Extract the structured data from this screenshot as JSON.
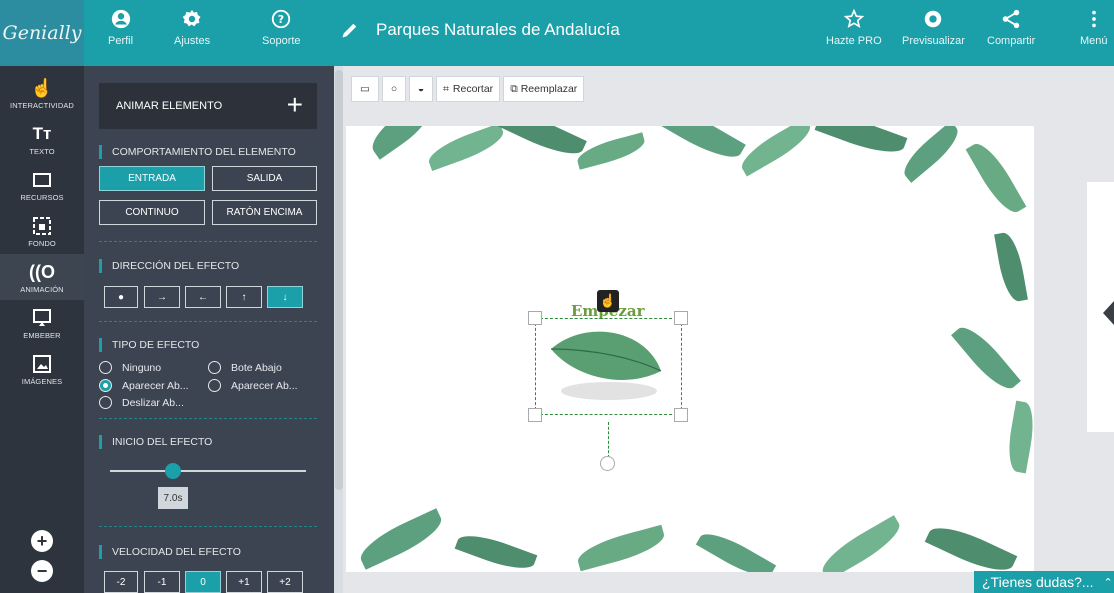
{
  "topbar": {
    "logo": "Genially",
    "perfil": "Perfil",
    "ajustes": "Ajustes",
    "soporte": "Soporte",
    "title": "Parques Naturales de Andalucía",
    "hazte_pro": "Hazte PRO",
    "previsualizar": "Previsualizar",
    "compartir": "Compartir",
    "menu": "Menú"
  },
  "rail": {
    "items": [
      {
        "label": "INTERACTIVIDAD",
        "icon": "hand-pointer-icon"
      },
      {
        "label": "TEXTO",
        "icon": "text-icon"
      },
      {
        "label": "RECURSOS",
        "icon": "resources-icon"
      },
      {
        "label": "FONDO",
        "icon": "background-icon"
      },
      {
        "label": "ANIMACIÓN",
        "icon": "animation-icon"
      },
      {
        "label": "EMBEBER",
        "icon": "embed-icon"
      },
      {
        "label": "IMÁGENES",
        "icon": "images-icon"
      }
    ],
    "zoom_in": "+",
    "zoom_out": "−"
  },
  "panel": {
    "animar": "ANIMAR ELEMENTO",
    "comportamiento": "COMPORTAMIENTO DEL ELEMENTO",
    "entrada": "ENTRADA",
    "salida": "SALIDA",
    "continuo": "CONTINUO",
    "raton": "RATÓN ENCIMA",
    "direccion": "DIRECCIÓN DEL EFECTO",
    "tipo": "TIPO DE EFECTO",
    "efectos": [
      "Ninguno",
      "Bote Abajo",
      "Aparecer Ab...",
      "Aparecer Ab...",
      "Deslizar Ab..."
    ],
    "selected_effect": "Aparecer Ab...",
    "inicio": "INICIO DEL EFECTO",
    "inicio_value": "7.0s",
    "inicio_fraction": 0.32,
    "velocidad": "VELOCIDAD DEL EFECTO",
    "speeds": [
      "-2",
      "-1",
      "0",
      "+1",
      "+2"
    ],
    "selected_speed": "0"
  },
  "toolbar": {
    "recortar": "Recortar",
    "reemplazar": "Reemplazar"
  },
  "slide": {
    "element_text": "Empezar"
  },
  "help": "¿Tienes dudas?...",
  "colors": {
    "accent": "#1b9fa9",
    "rail": "#2e343d",
    "panel": "#3d4451"
  }
}
